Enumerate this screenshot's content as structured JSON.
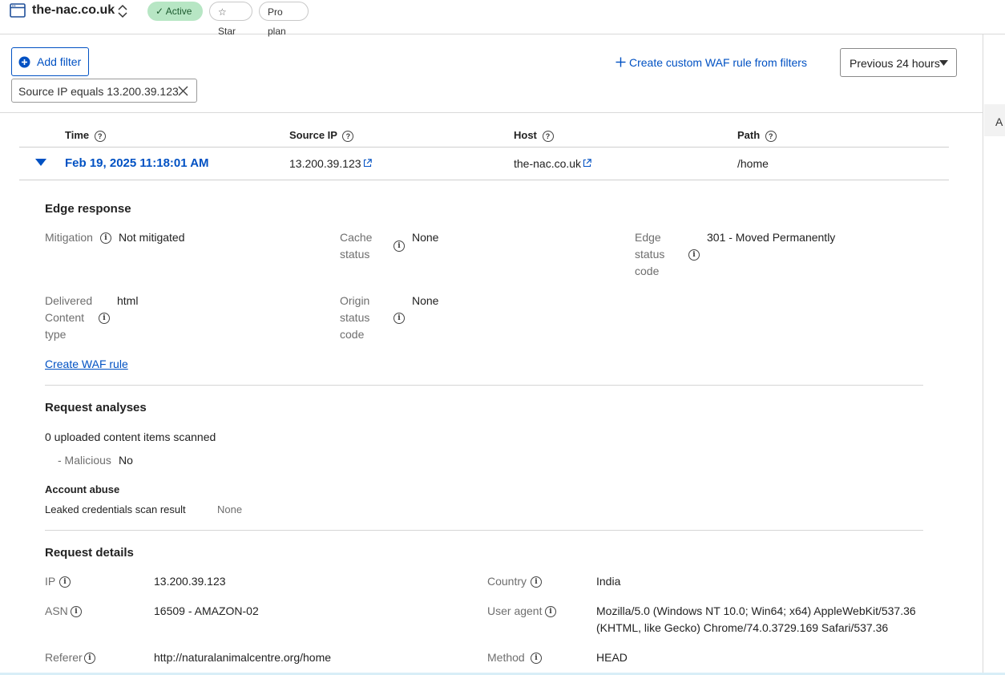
{
  "header": {
    "domain": "the-nac.co.uk",
    "status_badge": "Active",
    "star_label": "Star",
    "plan_label": "Pro plan"
  },
  "filters": {
    "add_filter_label": "Add filter",
    "create_rule_label": "Create custom WAF rule from filters",
    "time_range": "Previous 24 hours",
    "active_filter": "Source IP equals 13.200.39.123"
  },
  "table": {
    "columns": [
      "Time",
      "Source IP",
      "Host",
      "Path"
    ],
    "row": {
      "time": "Feb 19, 2025 11:18:01 AM",
      "source_ip": "13.200.39.123",
      "host": "the-nac.co.uk",
      "path": "/home"
    }
  },
  "edge_response": {
    "title": "Edge response",
    "mitigation_label": "Mitigation",
    "mitigation_value": "Not mitigated",
    "cache_label_1": "Cache",
    "cache_label_2": "status",
    "cache_value": "None",
    "edge_label_1": "Edge",
    "edge_label_2": "status",
    "edge_label_3": "code",
    "edge_value": "301 - Moved Permanently",
    "delivered_label_1": "Delivered",
    "delivered_label_2": "Content",
    "delivered_label_3": "type",
    "delivered_value": "html",
    "origin_label_1": "Origin",
    "origin_label_2": "status",
    "origin_label_3": "code",
    "origin_value": "None",
    "create_waf_rule": "Create WAF rule"
  },
  "request_analyses": {
    "title": "Request analyses",
    "scanned": "0 uploaded content items scanned",
    "malicious_label": "- Malicious",
    "malicious_value": "No",
    "account_abuse_title": "Account abuse",
    "leaked_label": "Leaked credentials scan result",
    "leaked_value": "None"
  },
  "request_details": {
    "title": "Request details",
    "ip_label": "IP",
    "ip_value": "13.200.39.123",
    "country_label": "Country",
    "country_value": "India",
    "asn_label": "ASN",
    "asn_value": "16509 - AMAZON-02",
    "ua_label": "User agent",
    "ua_line1": "Mozilla/5.0 (Windows NT 10.0; Win64; x64) AppleWebKit/537.36",
    "ua_line2": "(KHTML, like Gecko) Chrome/74.0.3729.169 Safari/537.36",
    "referer_label": "Referer",
    "referer_value": "http://naturalanimalcentre.org/home",
    "method_label": "Method",
    "method_value": "HEAD"
  },
  "side_panel": {
    "letter": "A"
  },
  "colors": {
    "accent": "#0051c3",
    "active_badge_bg": "#b7e6c4"
  }
}
